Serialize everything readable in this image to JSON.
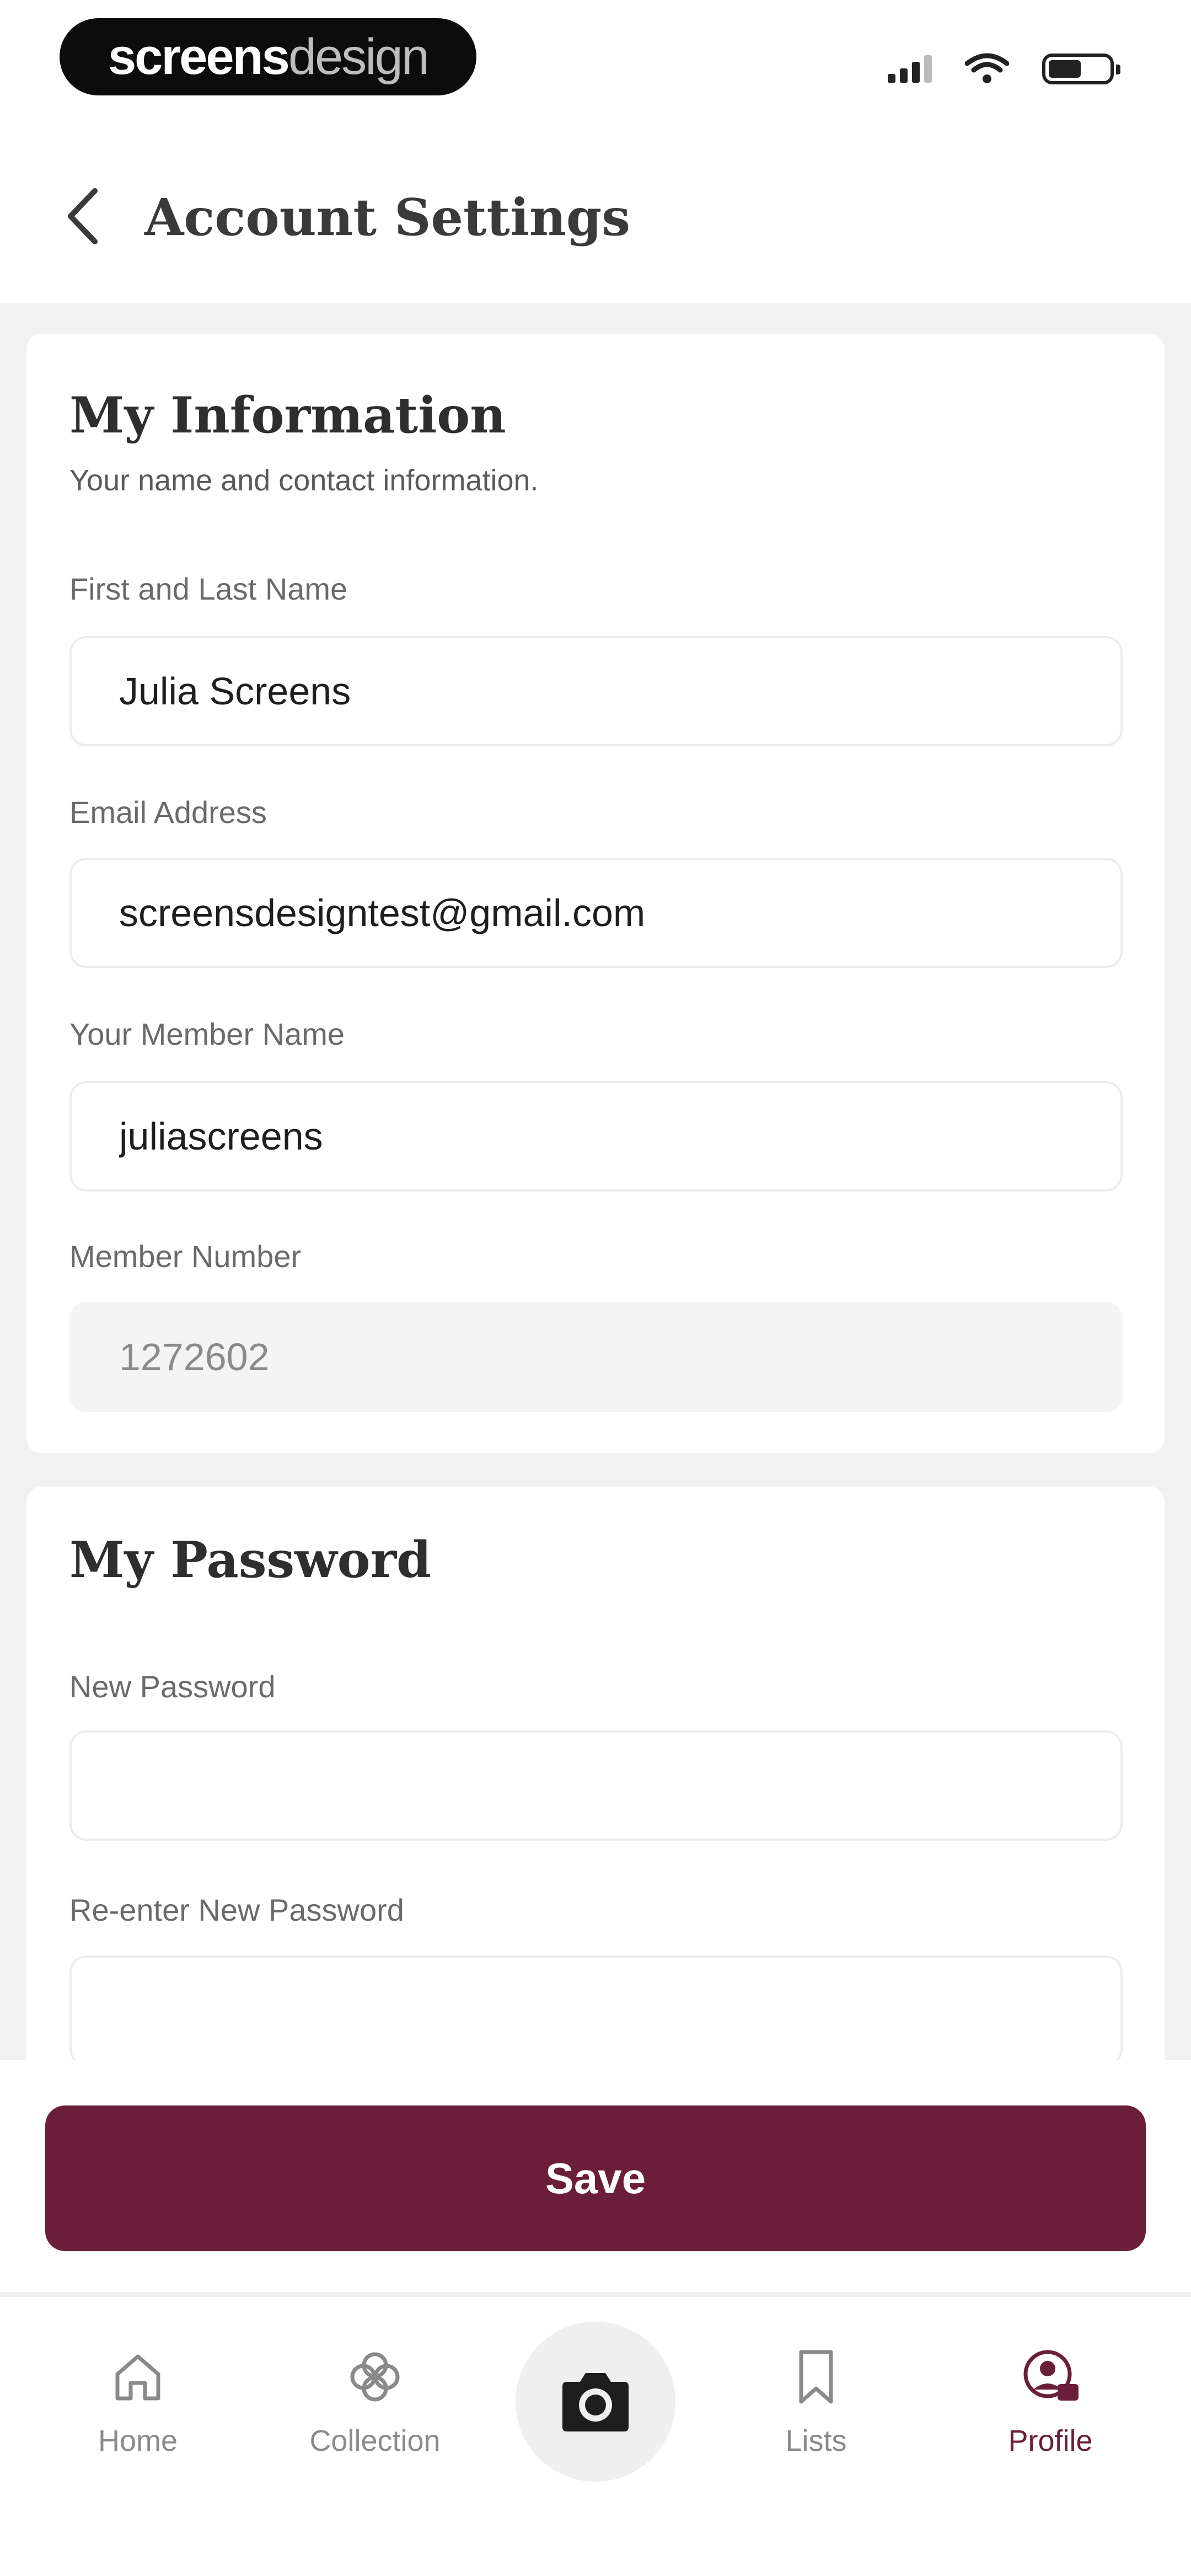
{
  "status_bar": {
    "brand_bold": "screens",
    "brand_light": "design"
  },
  "header": {
    "title": "Account Settings"
  },
  "my_information": {
    "title": "My Information",
    "subtitle": "Your name and contact information.",
    "name_label": "First and Last Name",
    "name_value": "Julia Screens",
    "email_label": "Email Address",
    "email_value": "screensdesigntest@gmail.com",
    "member_name_label": "Your Member Name",
    "member_name_value": "juliascreens",
    "member_number_label": "Member Number",
    "member_number_value": "1272602"
  },
  "my_password": {
    "title": "My Password",
    "new_label": "New Password",
    "new_value": "",
    "reenter_label": "Re-enter New Password",
    "reenter_value": ""
  },
  "actions": {
    "save_label": "Save"
  },
  "tab_bar": {
    "home": "Home",
    "collection": "Collection",
    "lists": "Lists",
    "profile": "Profile",
    "active": "profile"
  },
  "colors": {
    "accent": "#6b1e3a",
    "background": "#f1f1f1",
    "card": "#ffffff",
    "muted_text": "#8a8a8a"
  }
}
